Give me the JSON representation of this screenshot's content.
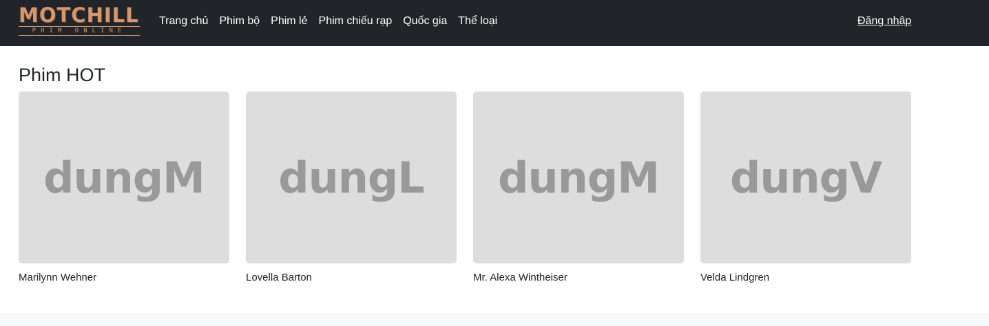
{
  "header": {
    "logo": {
      "main": "MOTCHILL",
      "sub": "PHIM ONLINE"
    },
    "nav": [
      {
        "label": "Trang chủ"
      },
      {
        "label": "Phim bộ"
      },
      {
        "label": "Phim lẻ"
      },
      {
        "label": "Phim chiếu rạp"
      },
      {
        "label": "Quốc gia"
      },
      {
        "label": "Thể loại"
      }
    ],
    "login_label": "Đăng nhập"
  },
  "main": {
    "section_title": "Phim HOT",
    "movies": [
      {
        "poster_text": "dungM",
        "title": "Marilynn Wehner"
      },
      {
        "poster_text": "dungL",
        "title": "Lovella Barton"
      },
      {
        "poster_text": "dungM",
        "title": "Mr. Alexa Wintheiser"
      },
      {
        "poster_text": "dungV",
        "title": "Velda Lindgren"
      }
    ]
  },
  "colors": {
    "navbar_bg": "#212529",
    "logo_accent": "#d39772",
    "poster_bg": "#dddddd",
    "poster_text": "#999999"
  }
}
